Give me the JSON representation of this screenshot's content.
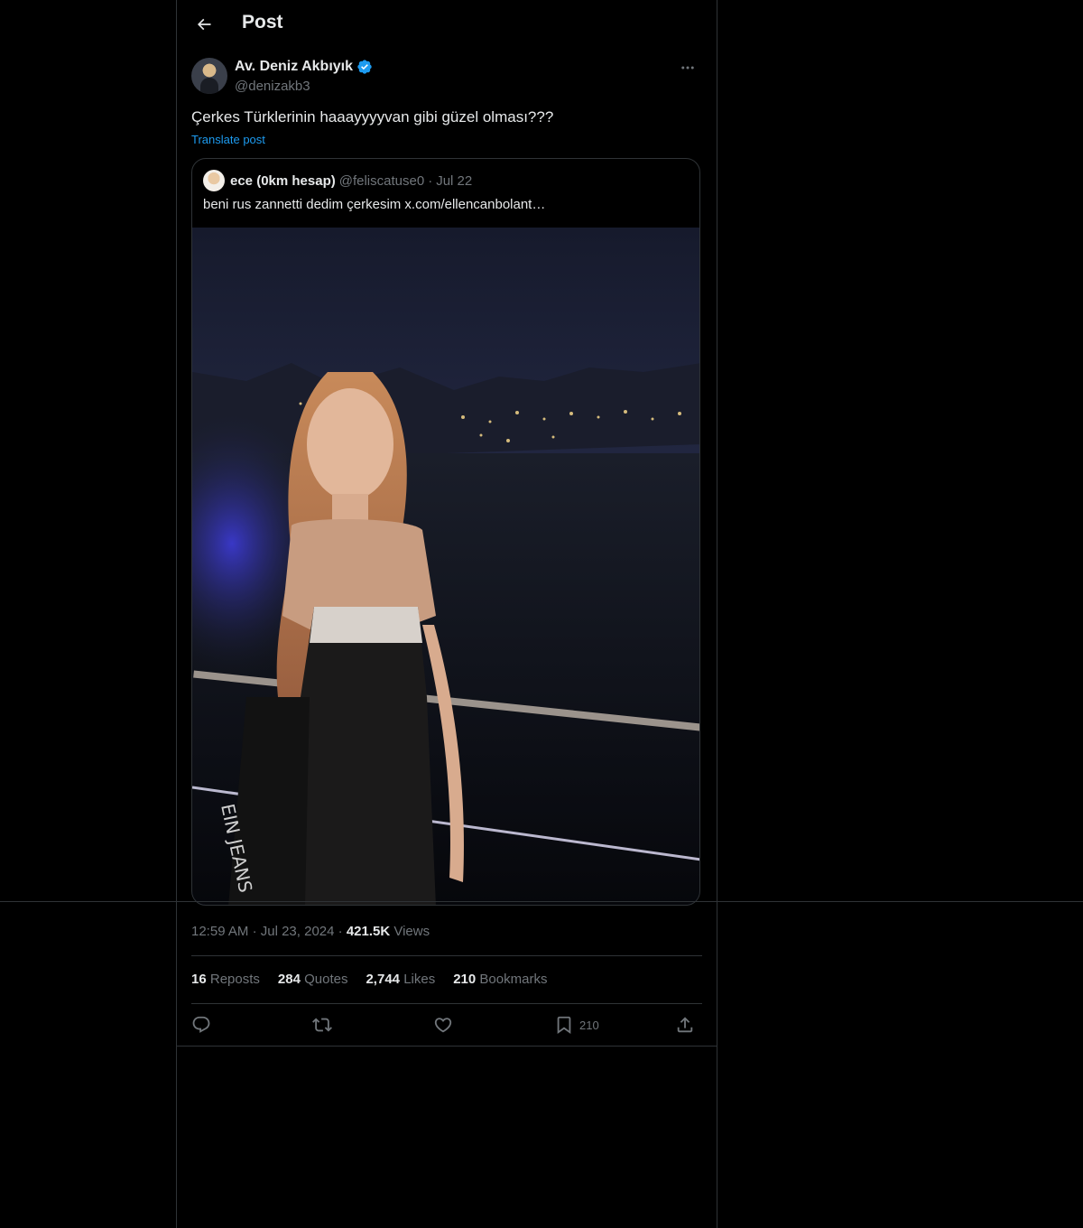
{
  "header": {
    "title": "Post"
  },
  "post": {
    "author_name": "Av. Deniz Akbıyık",
    "author_handle": "@denizakb3",
    "verified": true,
    "text": "Çerkes Türklerinin haaayyyyvan gibi güzel olması???",
    "translate_label": "Translate post",
    "quote": {
      "name": "ece (0km hesap)",
      "handle": "@feliscatuse0",
      "separator": "·",
      "date": "Jul 22",
      "text": "beni rus zannetti dedim çerkesim  x.com/ellencanbolant…"
    },
    "meta": {
      "time": "12:59 AM",
      "sep1": "·",
      "date": "Jul 23, 2024",
      "sep2": "·",
      "views_count": "421.5K",
      "views_label": "Views"
    },
    "stats": {
      "reposts_count": "16",
      "reposts_label": "Reposts",
      "quotes_count": "284",
      "quotes_label": "Quotes",
      "likes_count": "2,744",
      "likes_label": "Likes",
      "bookmarks_count": "210",
      "bookmarks_label": "Bookmarks"
    },
    "actions": {
      "reply_icon": "reply-icon",
      "repost_icon": "repost-icon",
      "like_icon": "heart-icon",
      "bookmark_icon": "bookmark-icon",
      "bookmark_count": "210",
      "share_icon": "share-icon"
    }
  },
  "colors": {
    "background": "#000000",
    "text": "#e7e9ea",
    "muted": "#71767b",
    "accent": "#1d9bf0",
    "border": "#2f3336"
  }
}
